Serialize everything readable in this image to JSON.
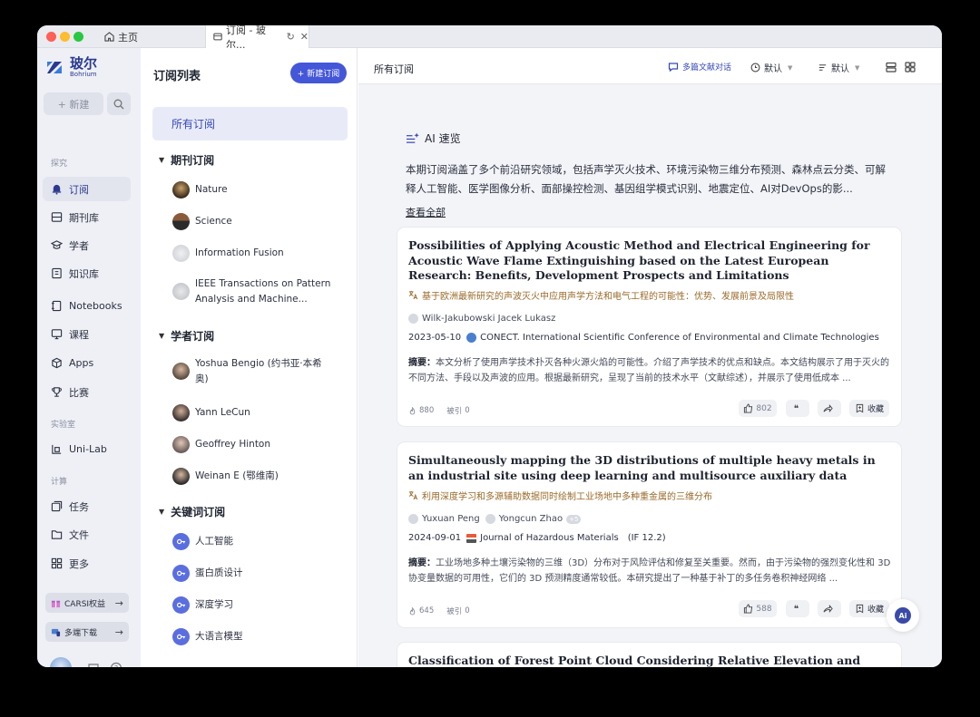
{
  "browser": {
    "tab_home": "主页",
    "tab_active": "订阅 - 玻尔..."
  },
  "brand": {
    "name_cn": "玻尔",
    "name_en": "Bohrium"
  },
  "nav": {
    "new_label": "+ 新建",
    "section_explore": "探究",
    "section_lab": "实验室",
    "section_compute": "计算",
    "items": {
      "subscribe": "订阅",
      "journals": "期刊库",
      "scholars": "学者",
      "knowledge": "知识库",
      "notebooks": "Notebooks",
      "courses": "课程",
      "apps": "Apps",
      "contests": "比赛",
      "unilab": "Uni-Lab",
      "tasks": "任务",
      "files": "文件",
      "more": "更多"
    },
    "promo_carsi": "CARSI权益",
    "promo_download": "多端下载"
  },
  "sublist": {
    "title": "订阅列表",
    "new_button": "+ 新建订阅",
    "all": "所有订阅",
    "journal_header": "期刊订阅",
    "journals": [
      "Nature",
      "Science",
      "Information Fusion",
      "IEEE Transactions on Pattern Analysis and Machine..."
    ],
    "scholar_header": "学者订阅",
    "scholars": [
      "Yoshua Bengio (约书亚·本希奥)",
      "Yann LeCun",
      "Geoffrey Hinton",
      "Weinan E (鄂维南)"
    ],
    "keyword_header": "关键词订阅",
    "keywords": [
      "人工智能",
      "蛋白质设计",
      "深度学习",
      "大语言模型"
    ]
  },
  "main": {
    "title": "所有订阅",
    "multi_chat": "多篇文献对话",
    "sort1": "默认",
    "sort2": "默认",
    "ai_title": "AI 速览",
    "ai_summary": "本期订阅涵盖了多个前沿研究领域，包括声学灭火技术、环境污染物三维分布预测、森林点云分类、可解释人工智能、医学图像分析、面部操控检测、基因组学模式识别、地震定位、AI对DevOps的影...",
    "ai_more": "查看全部",
    "save_label": "收藏",
    "cited_prefix": "被引",
    "abstract_label": "摘要："
  },
  "papers": [
    {
      "title": "Possibilities of Applying Acoustic Method and Electrical Engineering for Acoustic Wave Flame Extinguishing based on the Latest European Research: Benefits, Development Prospects and Limitations",
      "translation": "基于欧洲最新研究的声波灭火中应用声学方法和电气工程的可能性：优势、发展前景及局限性",
      "authors": [
        "Wilk-Jakubowski Jacek Lukasz"
      ],
      "date": "2023-05-10",
      "venue": "CONECT. International Scientific Conference of Environmental and Climate Technologies",
      "abstract": "本文分析了使用声学技术扑灭各种火源火焰的可能性。介绍了声学技术的优点和缺点。本文结构展示了用于灭火的不同方法、手段以及声波的应用。根据最新研究，呈现了当前的技术水平（文献综述），并展示了使用低成本 ...",
      "views": "880",
      "cited": "0",
      "likes": "802"
    },
    {
      "title": "Simultaneously mapping the 3D distributions of multiple heavy metals in an industrial site using deep learning and multisource auxiliary data",
      "translation": "利用深度学习和多源辅助数据同时绘制工业场地中多种重金属的三维分布",
      "authors": [
        "Yuxuan Peng",
        "Yongcun Zhao"
      ],
      "more_authors": "+5",
      "date": "2024-09-01",
      "venue": "Journal of Hazardous Materials",
      "impact": "(IF 12.2)",
      "abstract": "工业场地多种土壤污染物的三维（3D）分布对于风险评估和修复至关重要。然而，由于污染物的强烈变化性和 3D 协变量数据的可用性，它们的 3D 预测精度通常较低。本研究提出了一种基于补丁的多任务卷积神经网络 ...",
      "views": "645",
      "cited": "0",
      "likes": "588"
    },
    {
      "title": "Classification of Forest Point Cloud Considering Relative Elevation and Change of Curvature Using RandLA-Net"
    }
  ],
  "colors": {
    "accent": "#4457d8",
    "nav_bg": "#eef0f6",
    "main_bg": "#f3f4f8",
    "translation": "#9a6a2a"
  },
  "icons": [
    "home-icon",
    "page-icon",
    "reload-icon",
    "close-icon",
    "bohrium-logo",
    "search-icon",
    "bell-icon",
    "journal-icon",
    "scholar-icon",
    "book-icon",
    "notebook-icon",
    "course-icon",
    "apps-icon",
    "trophy-icon",
    "lab-icon",
    "task-icon",
    "folder-icon",
    "grid-icon",
    "chat-icon",
    "help-icon",
    "sparkle-icon",
    "translate-icon",
    "thumb-icon",
    "quote-icon",
    "share-icon",
    "bookmark-icon",
    "key-icon",
    "clock-icon",
    "sort-icon"
  ]
}
